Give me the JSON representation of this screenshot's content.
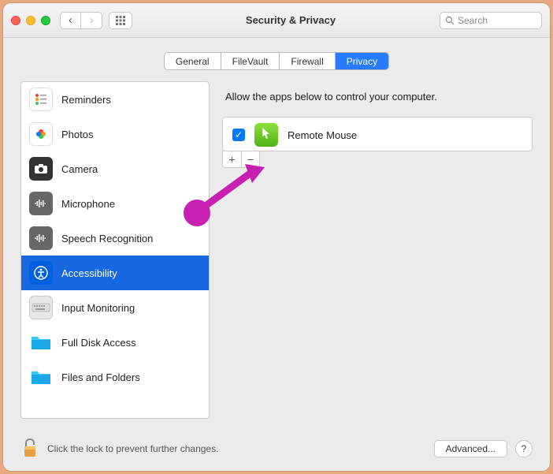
{
  "window": {
    "title": "Security & Privacy",
    "search_placeholder": "Search"
  },
  "tabs": [
    {
      "label": "General"
    },
    {
      "label": "FileVault"
    },
    {
      "label": "Firewall"
    },
    {
      "label": "Privacy",
      "active": true
    }
  ],
  "sidebar": {
    "items": [
      {
        "label": "Reminders",
        "icon": "reminders"
      },
      {
        "label": "Photos",
        "icon": "photos"
      },
      {
        "label": "Camera",
        "icon": "camera"
      },
      {
        "label": "Microphone",
        "icon": "microphone"
      },
      {
        "label": "Speech Recognition",
        "icon": "speech"
      },
      {
        "label": "Accessibility",
        "icon": "accessibility",
        "selected": true
      },
      {
        "label": "Input Monitoring",
        "icon": "keyboard"
      },
      {
        "label": "Full Disk Access",
        "icon": "folder"
      },
      {
        "label": "Files and Folders",
        "icon": "folder"
      }
    ]
  },
  "right": {
    "allow_text": "Allow the apps below to control your computer.",
    "apps": [
      {
        "label": "Remote Mouse",
        "checked": true
      }
    ],
    "plus": "+",
    "minus": "−"
  },
  "footer": {
    "lock_text": "Click the lock to prevent further changes.",
    "advanced_label": "Advanced...",
    "help_label": "?"
  },
  "colors": {
    "accent": "#287aff"
  }
}
